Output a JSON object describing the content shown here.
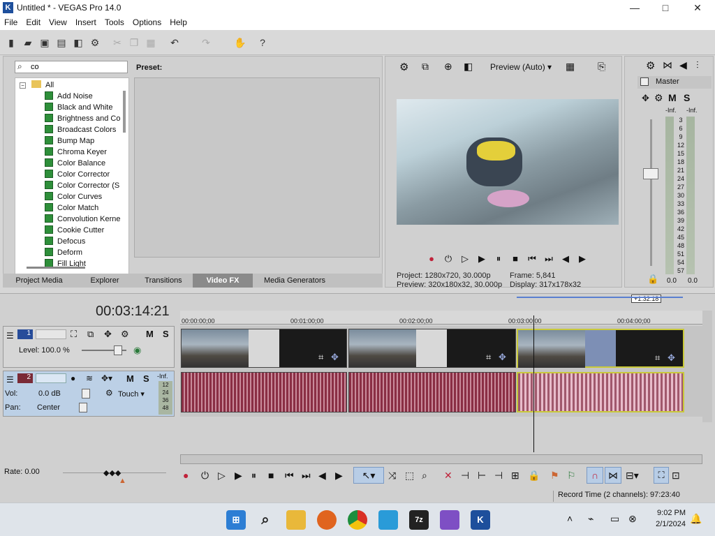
{
  "window": {
    "title": "Untitled * - VEGAS Pro 14.0",
    "logo": "K"
  },
  "window_controls": {
    "minimize": "—",
    "maximize": "□",
    "close": "✕"
  },
  "menu": [
    "File",
    "Edit",
    "View",
    "Insert",
    "Tools",
    "Options",
    "Help"
  ],
  "fx": {
    "search_value": "co",
    "preset_label": "Preset:",
    "root": "All",
    "items": [
      "Add Noise",
      "Black and White",
      "Brightness and Co",
      "Broadcast Colors",
      "Bump Map",
      "Chroma Keyer",
      "Color Balance",
      "Color Corrector",
      "Color Corrector (S",
      "Color Curves",
      "Color Match",
      "Convolution Kerne",
      "Cookie Cutter",
      "Defocus",
      "Deform",
      "Fill Light"
    ],
    "tabs": [
      "Project Media",
      "Explorer",
      "Transitions",
      "Video FX",
      "Media Generators"
    ],
    "active_tab": "Video FX"
  },
  "preview": {
    "mode": "Preview (Auto)",
    "project_label": "Project:",
    "project_value": "1280x720, 30.000p",
    "preview_label": "Preview:",
    "preview_value": "320x180x32, 30.000p",
    "frame_label": "Frame:",
    "frame_value": "5,841",
    "display_label": "Display:",
    "display_value": "317x178x32"
  },
  "mixer": {
    "label": "Master",
    "m": "M",
    "s": "S",
    "inf_left": "-Inf.",
    "inf_right": "-Inf.",
    "scale": [
      "3",
      "6",
      "9",
      "12",
      "15",
      "18",
      "21",
      "24",
      "27",
      "30",
      "33",
      "36",
      "39",
      "42",
      "45",
      "48",
      "51",
      "54",
      "57"
    ],
    "bottom_left": "0.0",
    "bottom_right": "0.0"
  },
  "timeline": {
    "timecode": "00:03:14:21",
    "region": "+1:32:18",
    "ruler": [
      "00:00:00;00",
      "00:01:00;00",
      "00:02:00;00",
      "00:03:00;00",
      "00:04:00;00"
    ],
    "track1": {
      "number": "1",
      "m": "M",
      "s": "S",
      "level_label": "Level: 100.0 %"
    },
    "track2": {
      "number": "2",
      "m": "M",
      "s": "S",
      "vol_label": "Vol:",
      "vol_value": "0.0 dB",
      "pan_label": "Pan:",
      "pan_value": "Center",
      "touch": "Touch",
      "inf": "-Inf.",
      "scale": [
        "12",
        "24",
        "36",
        "48"
      ]
    },
    "rate": "Rate: 0.00"
  },
  "status": {
    "record_time": "Record Time (2 channels): 97:23:40"
  },
  "taskbar": {
    "time": "9:02 PM",
    "date": "2/1/2024"
  }
}
